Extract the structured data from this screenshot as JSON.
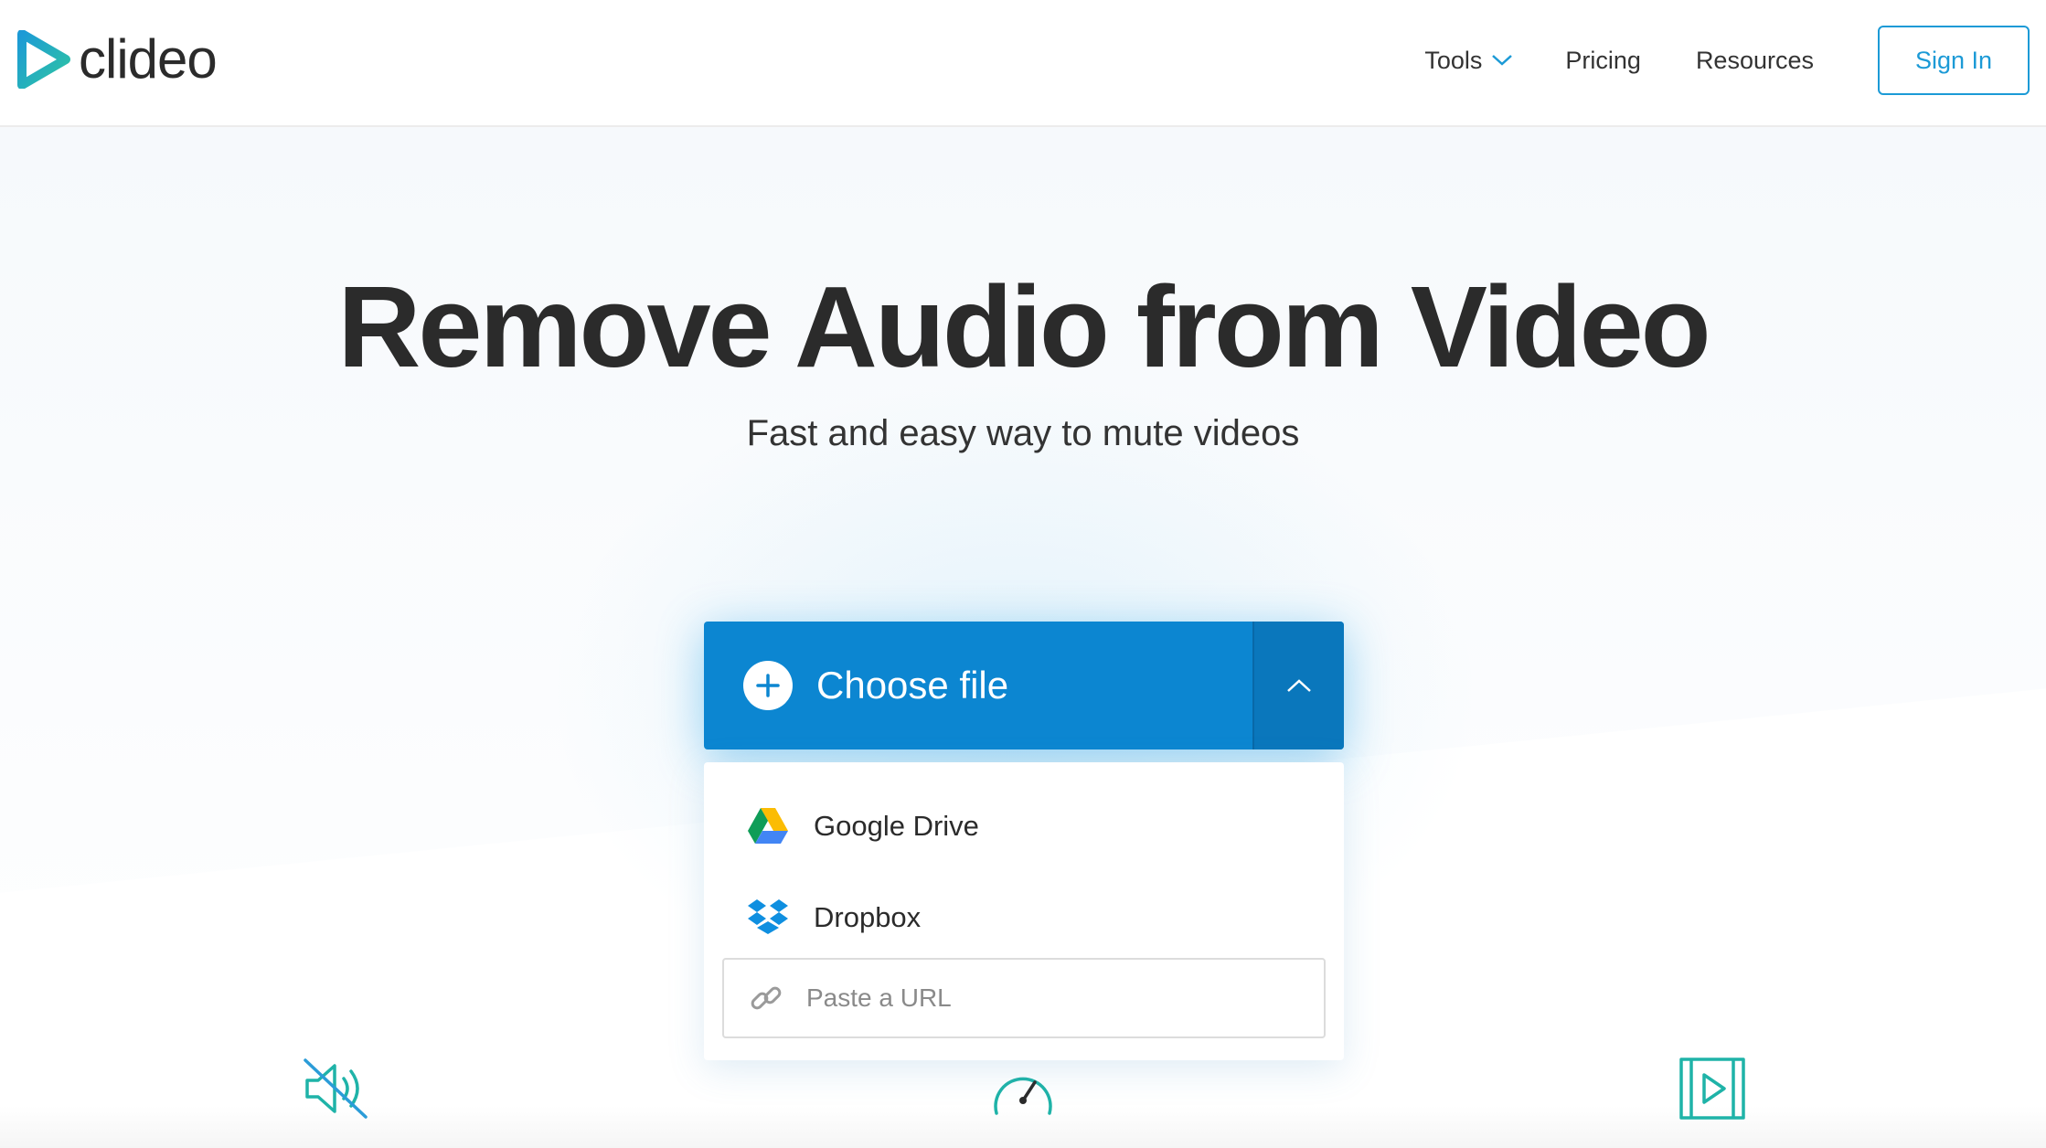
{
  "brand": {
    "name": "clideo",
    "accent": "#1c9ad6",
    "logo_gradient": [
      "#1c9ad6",
      "#2ec4a4"
    ]
  },
  "nav": {
    "tools_label": "Tools",
    "pricing_label": "Pricing",
    "resources_label": "Resources",
    "signin_label": "Sign In"
  },
  "hero": {
    "title": "Remove Audio from Video",
    "subtitle": "Fast and easy way to mute videos"
  },
  "uploader": {
    "choose_label": "Choose file",
    "button_color": "#0c86d1",
    "sources": [
      {
        "label": "Google Drive",
        "icon": "google-drive-icon"
      },
      {
        "label": "Dropbox",
        "icon": "dropbox-icon"
      }
    ],
    "url_placeholder": "Paste a URL",
    "url_value": ""
  },
  "features": [
    {
      "icon": "mute-speaker-icon"
    },
    {
      "icon": "speedometer-icon"
    },
    {
      "icon": "video-play-icon"
    }
  ]
}
